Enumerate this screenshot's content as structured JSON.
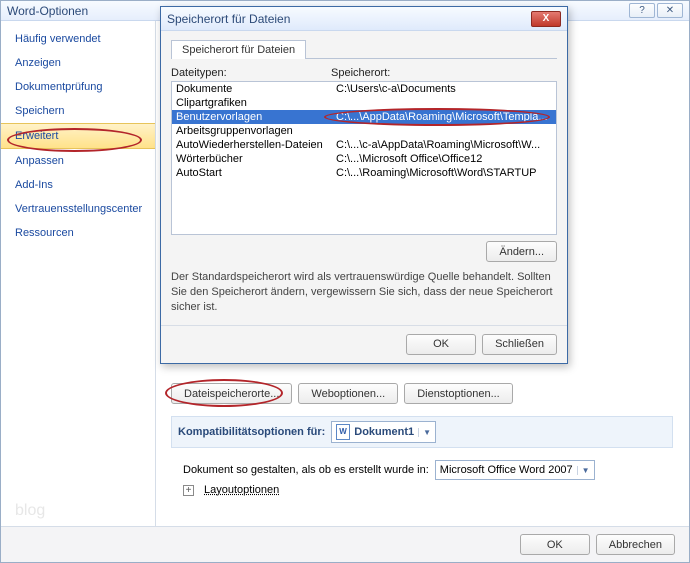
{
  "main": {
    "title": "Word-Optionen",
    "ok": "OK",
    "cancel": "Abbrechen"
  },
  "sidebar": {
    "items": [
      {
        "label": "Häufig verwendet"
      },
      {
        "label": "Anzeigen"
      },
      {
        "label": "Dokumentprüfung"
      },
      {
        "label": "Speichern"
      },
      {
        "label": "Erweitert"
      },
      {
        "label": "Anpassen"
      },
      {
        "label": "Add-Ins"
      },
      {
        "label": "Vertrauensstellungscenter"
      },
      {
        "label": "Ressourcen"
      }
    ]
  },
  "buttons": {
    "dateispeicherorte": "Dateispeicherorte...",
    "weboptionen": "Weboptionen...",
    "dienstoptionen": "Dienstoptionen..."
  },
  "kompat": {
    "label": "Kompatibilitätsoptionen für:",
    "doc": "Dokument1",
    "phrase": "Dokument so gestalten, als ob es erstellt wurde in:",
    "target": "Microsoft Office Word 2007",
    "layout": "Layoutoptionen"
  },
  "dialog": {
    "title": "Speicherort für Dateien",
    "tab": "Speicherort für Dateien",
    "col1": "Dateitypen:",
    "col2": "Speicherort:",
    "rows": [
      {
        "type": "Dokumente",
        "path": "C:\\Users\\c-a\\Documents"
      },
      {
        "type": "Clipartgrafiken",
        "path": ""
      },
      {
        "type": "Benutzervorlagen",
        "path": "C:\\...\\AppData\\Roaming\\Microsoft\\Templa..."
      },
      {
        "type": "Arbeitsgruppenvorlagen",
        "path": ""
      },
      {
        "type": "AutoWiederherstellen-Dateien",
        "path": "C:\\...\\c-a\\AppData\\Roaming\\Microsoft\\W..."
      },
      {
        "type": "Wörterbücher",
        "path": "C:\\...\\Microsoft Office\\Office12"
      },
      {
        "type": "AutoStart",
        "path": "C:\\...\\Roaming\\Microsoft\\Word\\STARTUP"
      }
    ],
    "change": "Ändern...",
    "note": "Der Standardspeicherort wird als vertrauenswürdige Quelle behandelt. Sollten Sie den Speicherort ändern, vergewissern Sie sich, dass der neue Speicherort sicher ist.",
    "ok": "OK",
    "close": "Schließen"
  },
  "watermark": "blog"
}
